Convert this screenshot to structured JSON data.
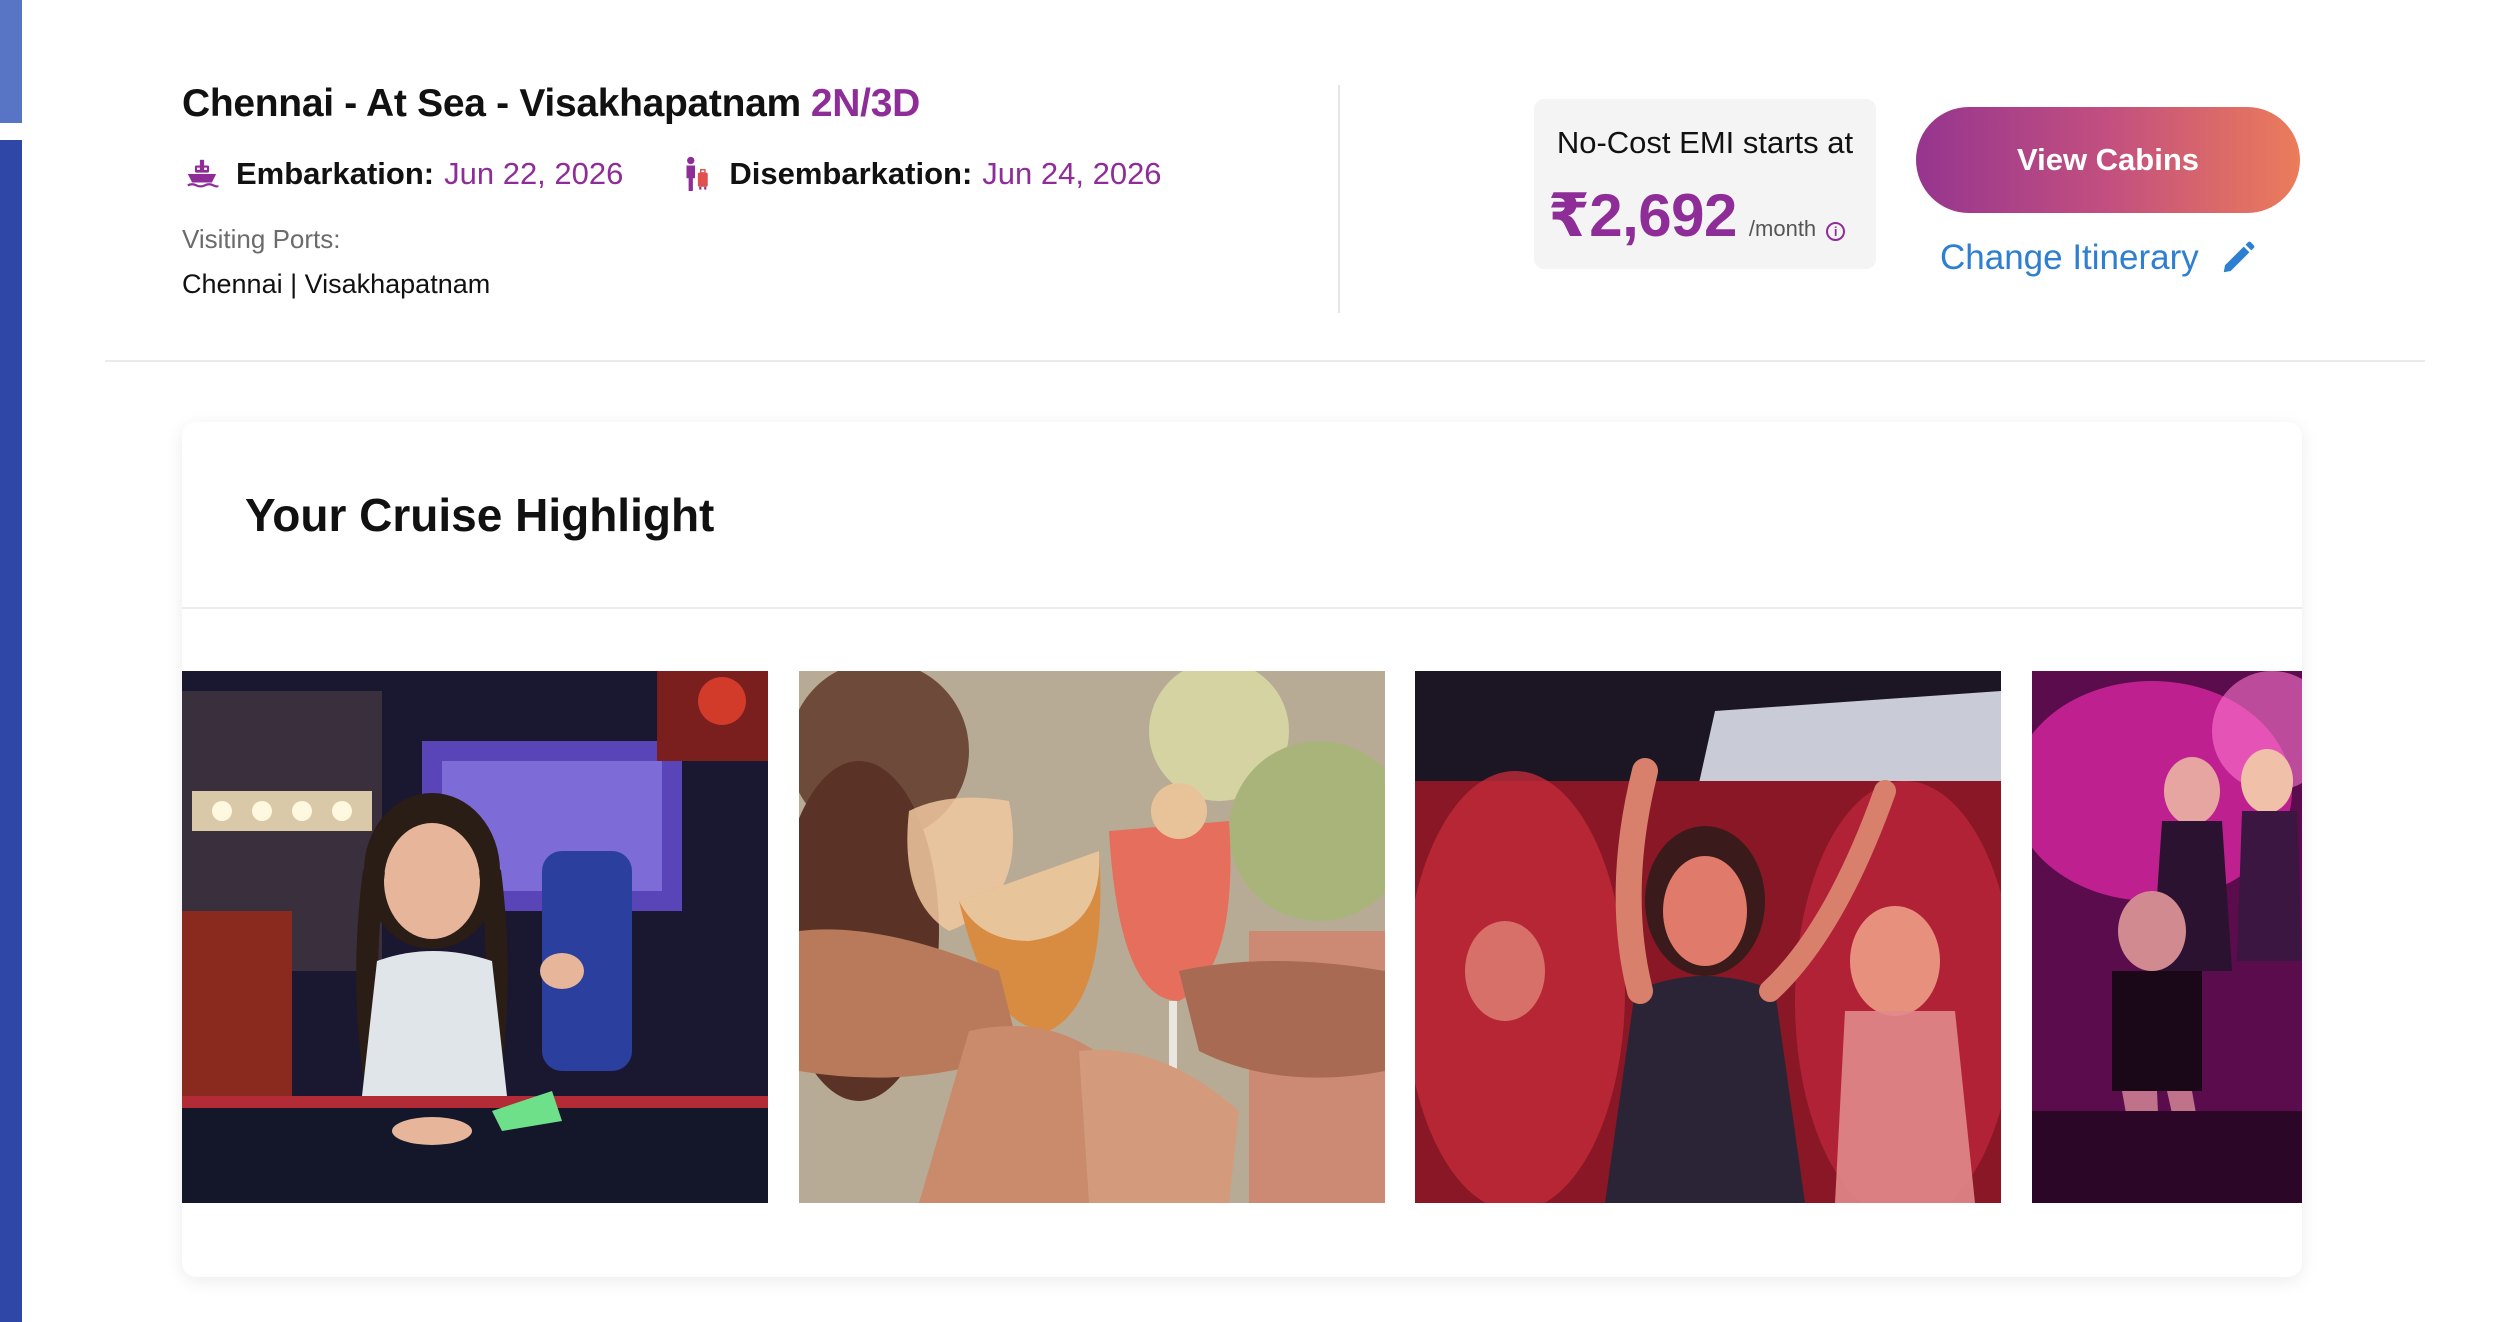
{
  "itinerary": {
    "route": "Chennai - At Sea - Visakhapatnam",
    "duration": "2N/3D",
    "embarkation_label": "Embarkation:",
    "embarkation_date": "Jun 22, 2026",
    "disembarkation_label": "Disembarkation:",
    "disembarkation_date": "Jun 24, 2026",
    "visiting_ports_label": "Visiting Ports:",
    "visiting_ports": "Chennai | Visakhapatnam"
  },
  "emi": {
    "label": "No-Cost EMI starts at",
    "price": "₹2,692",
    "per": "/month",
    "info_icon": "info-icon"
  },
  "actions": {
    "view_cabins": "View Cabins",
    "change_itinerary": "Change Itinerary",
    "change_itinerary_icon": "pencil-icon"
  },
  "highlights": {
    "title": "Your Cruise Highlight",
    "images": [
      {
        "subject": "arcade-girl-air-hockey"
      },
      {
        "subject": "cocktail-toast"
      },
      {
        "subject": "party-dancing-red"
      },
      {
        "subject": "stage-dancers-pink"
      }
    ]
  },
  "colors": {
    "accent_purple": "#8e2d98",
    "link_blue": "#2e7fd1",
    "button_gradient_start": "#96358f",
    "button_gradient_end": "#ec7c5a"
  }
}
